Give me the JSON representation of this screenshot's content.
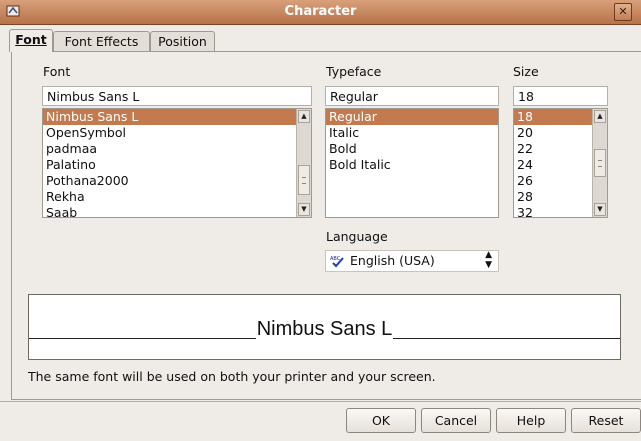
{
  "window": {
    "title": "Character",
    "close_glyph": "✕"
  },
  "tabs": [
    {
      "label": "Font",
      "active": true
    },
    {
      "label": "Font Effects",
      "active": false
    },
    {
      "label": "Position",
      "active": false
    }
  ],
  "font": {
    "label": "Font",
    "value": "Nimbus Sans L",
    "items": [
      "Nimbus Sans L",
      "OpenSymbol",
      "padmaa",
      "Palatino",
      "Pothana2000",
      "Rekha",
      "Saab"
    ],
    "selected_index": 0
  },
  "typeface": {
    "label": "Typeface",
    "value": "Regular",
    "items": [
      "Regular",
      "Italic",
      "Bold",
      "Bold Italic"
    ],
    "selected_index": 0
  },
  "size": {
    "label": "Size",
    "value": "18",
    "items": [
      "18",
      "20",
      "22",
      "24",
      "26",
      "28",
      "32"
    ],
    "selected_index": 0
  },
  "language": {
    "label": "Language",
    "value": "English (USA)",
    "icon": "spellcheck-icon"
  },
  "preview": {
    "text": "Nimbus Sans L"
  },
  "note": "The same font will be used on both your printer and your screen.",
  "buttons": {
    "ok": "OK",
    "cancel": "Cancel",
    "help": "Help",
    "reset": "Reset"
  },
  "colors": {
    "titlebar": "#c07c52",
    "selection": "#c27a4e",
    "dialog_bg": "#efebe7"
  }
}
